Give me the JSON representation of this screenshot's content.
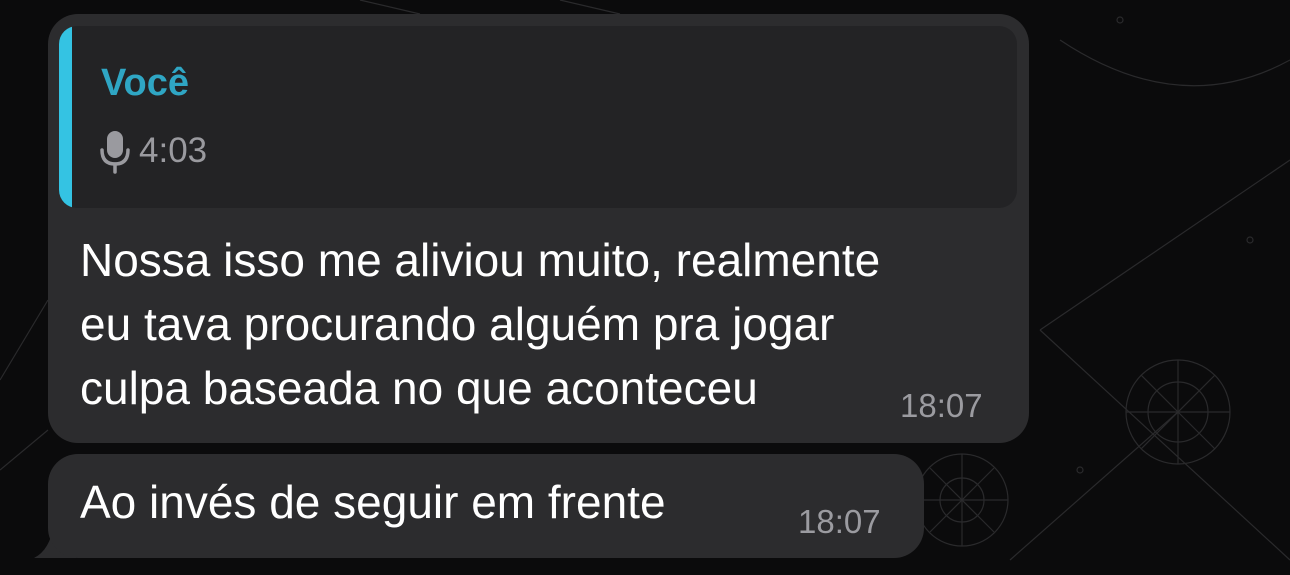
{
  "colors": {
    "background": "#0b0b0c",
    "bubble": "#2c2c2e",
    "quote_background": "#232325",
    "quote_accent": "#34c3e3",
    "quote_author": "#2fa6c4",
    "text": "#ffffff",
    "timestamp": "#9b9ba0"
  },
  "messages": [
    {
      "reply_to": {
        "author": "Você",
        "icon": "microphone-icon",
        "duration": "4:03"
      },
      "text": "Nossa isso me aliviou muito, realmente\neu tava procurando alguém pra jogar\nculpa baseada no que aconteceu",
      "time": "18:07"
    },
    {
      "text": "Ao invés de seguir em frente",
      "time": "18:07"
    }
  ]
}
